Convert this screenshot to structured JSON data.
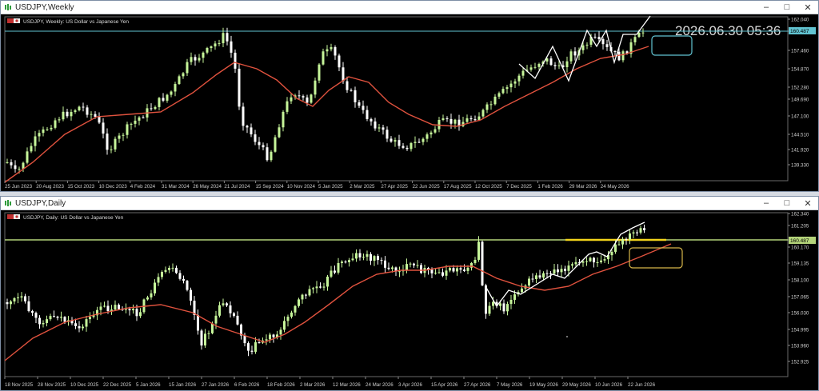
{
  "weekly": {
    "window_title": "USDJPY,Weekly",
    "chart_label": "USDJPY, Weekly:  US Dollar vs Japanese Yen",
    "timestamp": "2026.06.30 05:36",
    "price_ticks": [
      "162.040",
      "160.487",
      "157.460",
      "154.870",
      "152.280",
      "149.690",
      "147.100",
      "144.510",
      "141.920",
      "139.330"
    ],
    "current_price": "160.487",
    "date_ticks": [
      "25 Jun 2023",
      "20 Aug 2023",
      "15 Oct 2023",
      "10 Dec 2023",
      "4 Feb 2024",
      "31 Mar 2024",
      "26 May 2024",
      "21 Jul 2024",
      "15 Sep 2024",
      "10 Nov 2024",
      "5 Jan 2025",
      "2 Mar 2025",
      "27 Apr 2025",
      "22 Jun 2025",
      "17 Aug 2025",
      "12 Oct 2025",
      "7 Dec 2025",
      "1 Feb 2026",
      "29 Mar 2026",
      "24 May 2026"
    ]
  },
  "daily": {
    "window_title": "USDJPY,Daily",
    "chart_label": "USDJPY, Daily:  US Dollar vs Japanese Yen",
    "price_ticks": [
      "162.340",
      "161.205",
      "160.487",
      "160.170",
      "159.135",
      "158.100",
      "157.065",
      "156.030",
      "154.995",
      "153.960",
      "152.925"
    ],
    "current_price": "160.487",
    "date_ticks": [
      "18 Nov 2025",
      "28 Nov 2025",
      "10 Dec 2025",
      "22 Dec 2025",
      "5 Jan 2026",
      "15 Jan 2026",
      "27 Jan 2026",
      "6 Feb 2026",
      "18 Feb 2026",
      "2 Mar 2026",
      "12 Mar 2026",
      "24 Mar 2026",
      "3 Apr 2026",
      "15 Apr 2026",
      "27 Apr 2026",
      "7 May 2026",
      "19 May 2026",
      "29 May 2026",
      "10 Jun 2026",
      "22 Jun 2026"
    ]
  },
  "colors": {
    "bull": "#c6f59a",
    "bear": "#ffffff",
    "ma": "#e0523e",
    "weekly_line": "#62c4d2",
    "daily_line": "#b4d47a",
    "daily_zone": "#f2d31b",
    "weekly_box": "#62c4d2",
    "daily_box": "#d8b74a"
  }
}
